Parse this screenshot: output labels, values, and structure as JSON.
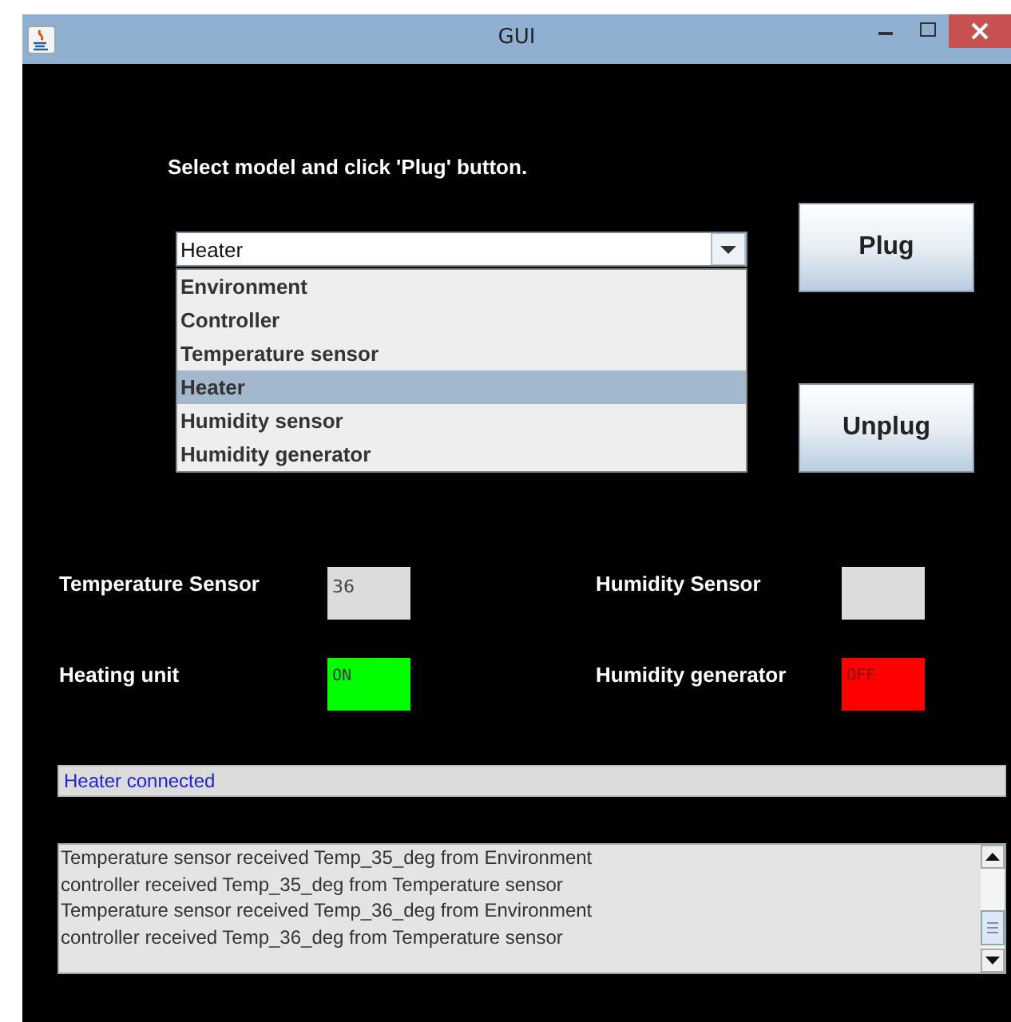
{
  "window": {
    "title": "GUI"
  },
  "prompt": "Select model and click 'Plug' button.",
  "model_combo": {
    "value": "Heater",
    "expanded": true,
    "options": [
      {
        "label": "Environment",
        "selected": false
      },
      {
        "label": "Controller",
        "selected": false
      },
      {
        "label": "Temperature sensor",
        "selected": false
      },
      {
        "label": "Heater",
        "selected": true
      },
      {
        "label": "Humidity sensor",
        "selected": false
      },
      {
        "label": "Humidity generator",
        "selected": false
      }
    ]
  },
  "buttons": [
    {
      "label": "Plug"
    },
    {
      "label": "Unplug"
    }
  ],
  "indicators": [
    {
      "label": "Temperature Sensor",
      "kind": "reading",
      "value": "36"
    },
    {
      "label": "Humidity Sensor",
      "kind": "reading"
    },
    {
      "label": "Heating unit",
      "kind": "switch",
      "value": "ON",
      "on": true
    },
    {
      "label": "Humidity generator",
      "kind": "switch",
      "value": "OFF",
      "on": false
    }
  ],
  "status": "Heater connected",
  "log": {
    "lines": [
      "Temperature sensor received Temp_35_deg from Environment",
      "controller received Temp_35_deg from Temperature sensor",
      "Temperature sensor received Temp_36_deg from Environment",
      "controller received Temp_36_deg from Temperature sensor"
    ]
  }
}
